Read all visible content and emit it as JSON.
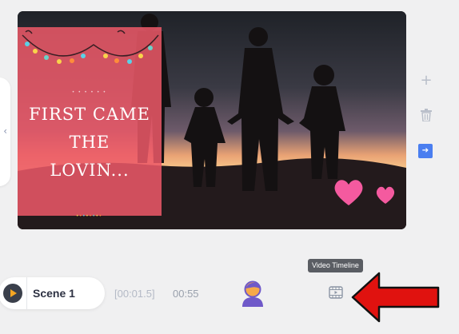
{
  "canvas": {
    "quote_lines": [
      "FIRST CAME",
      "THE",
      "LOVIN..."
    ]
  },
  "toolbar_right": {
    "add_icon": "plus-icon",
    "delete_icon": "trash-icon",
    "next_icon": "arrow-right-icon"
  },
  "timeline": {
    "scene_label": "Scene 1",
    "current_time": "[00:01.5]",
    "total_duration": "00:55",
    "tooltip": "Video Timeline"
  },
  "colors": {
    "accent": "#4a7ef0",
    "card": "#ec5868",
    "annotation": "#e0120f"
  }
}
